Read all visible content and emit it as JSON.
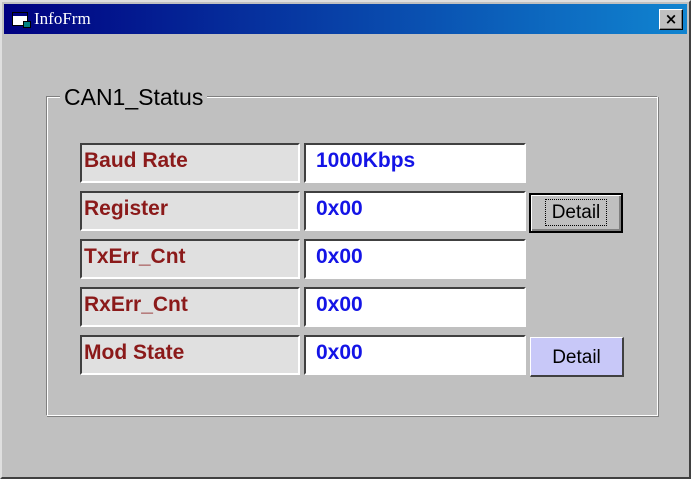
{
  "window": {
    "title": "InfoFrm",
    "close_label": "×"
  },
  "group": {
    "label": "CAN1_Status"
  },
  "rows": [
    {
      "label": "Baud Rate",
      "value": "1000Kbps"
    },
    {
      "label": "Register",
      "value": "0x00"
    },
    {
      "label": "TxErr_Cnt",
      "value": "0x00"
    },
    {
      "label": "RxErr_Cnt",
      "value": "0x00"
    },
    {
      "label": "Mod State",
      "value": "0x00"
    }
  ],
  "buttons": {
    "register_detail": "Detail",
    "mod_state_detail": "Detail"
  },
  "colors": {
    "label_text": "#8b1a1a",
    "value_text": "#1414e6",
    "mod_state_button": "#c8c8f8"
  }
}
